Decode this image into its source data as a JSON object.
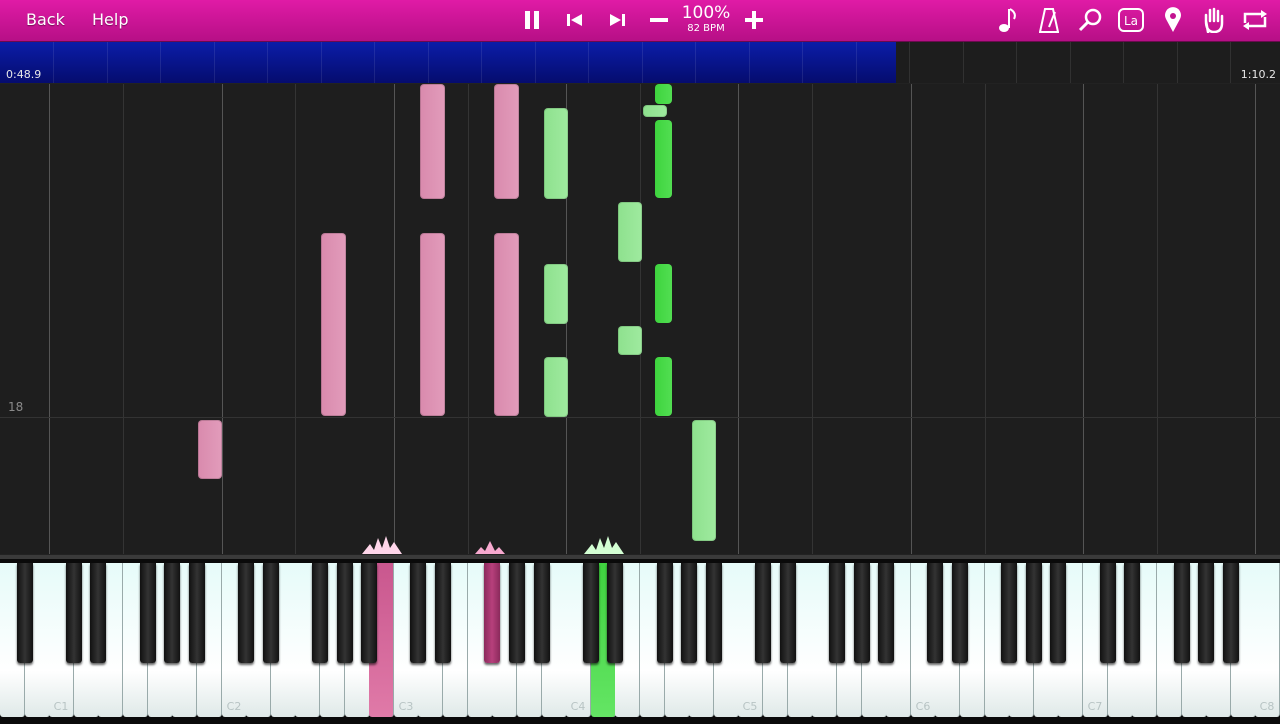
{
  "toolbar": {
    "back_label": "Back",
    "help_label": "Help",
    "speed": "100%",
    "bpm": "82 BPM",
    "icons": [
      "pause-icon",
      "skip-back-icon",
      "skip-forward-icon",
      "minus-icon",
      "plus-icon",
      "music-note-icon",
      "metronome-icon",
      "magnifier-icon",
      "la-label-icon",
      "marker-pin-icon",
      "hand-icon",
      "loop-icon"
    ],
    "la_text": "La"
  },
  "timeline": {
    "current_time": "0:48.9",
    "total_time": "1:10.2",
    "progress": 0.7,
    "fill_color": "#0a1a9a"
  },
  "roll": {
    "measure_number": "18"
  },
  "piano": {
    "octave_labels": [
      "C1",
      "C2",
      "C3",
      "C4",
      "C5",
      "C6",
      "C7",
      "C8"
    ],
    "colors": {
      "left_hand": "#e07aa8",
      "right_hand": "#52de52",
      "right_hand_light": "#9fea9f"
    }
  }
}
